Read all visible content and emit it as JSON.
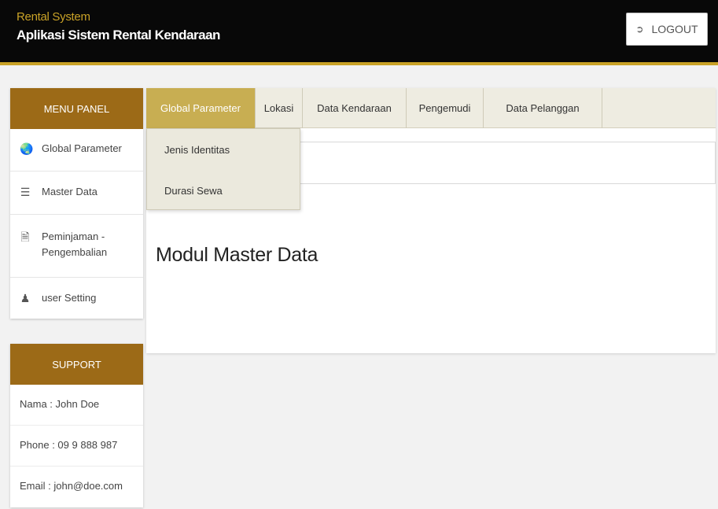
{
  "header": {
    "subtitle": "Rental System",
    "title": "Aplikasi Sistem Rental Kendaraan",
    "logout_label": "LOGOUT",
    "logout_icon": "logout-icon"
  },
  "sidebar": {
    "menu_title": "MENU PANEL",
    "items": [
      {
        "label": "Global Parameter",
        "icon": "globe-icon"
      },
      {
        "label": "Master Data",
        "icon": "database-icon"
      },
      {
        "label": "Peminjaman - Pengembalian",
        "icon": "document-icon"
      },
      {
        "label": "user Setting",
        "icon": "user-icon"
      }
    ],
    "support_title": "SUPPORT",
    "support": [
      "Nama : John Doe",
      "Phone : 09 9 888 987",
      "Email : john@doe.com"
    ]
  },
  "tabs": [
    {
      "label": "Global Parameter",
      "active": true
    },
    {
      "label": "Lokasi",
      "active": false
    },
    {
      "label": "Data Kendaraan",
      "active": false
    },
    {
      "label": "Pengemudi",
      "active": false
    },
    {
      "label": "Data Pelanggan",
      "active": false
    }
  ],
  "dropdown": [
    "Jenis Identitas",
    "Durasi Sewa"
  ],
  "main": {
    "module_title": "Modul Master Data"
  },
  "colors": {
    "topbar": "#080808",
    "accent_gold": "#c9a227",
    "panel_header": "#9c6a17",
    "active_tab": "#c8ae52"
  }
}
